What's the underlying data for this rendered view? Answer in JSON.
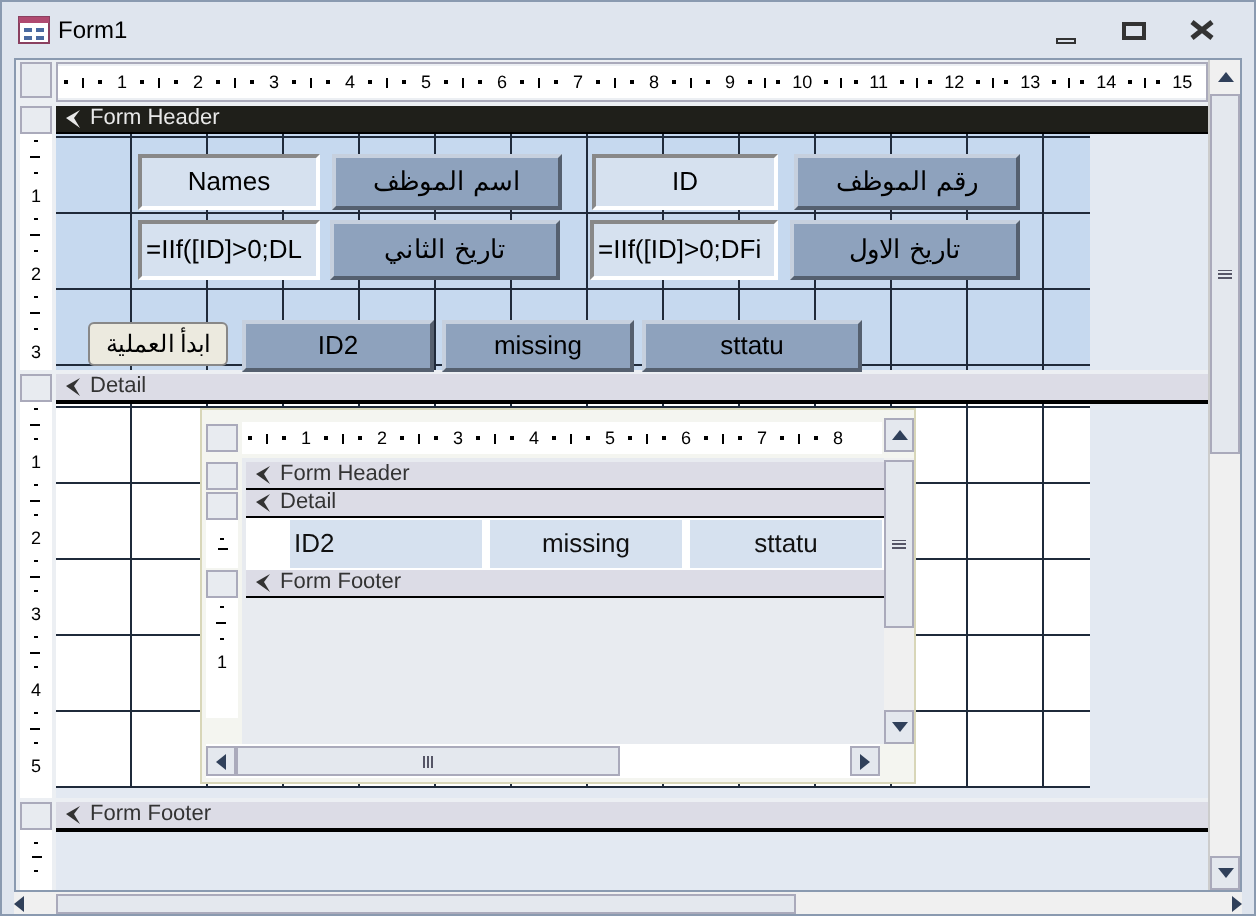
{
  "window": {
    "title": "Form1"
  },
  "ruler": [
    "1",
    "2",
    "3",
    "4",
    "5",
    "6",
    "7",
    "8",
    "9",
    "10",
    "11",
    "12",
    "13",
    "14",
    "15"
  ],
  "sections": [
    {
      "kind": "header",
      "title": "Form Header",
      "selected": true,
      "ruler": [
        "1",
        "2",
        "3"
      ],
      "controls": [
        {
          "kind": "textbox",
          "text": "Names"
        },
        {
          "kind": "label",
          "text": "اسم الموظف"
        },
        {
          "kind": "textbox",
          "text": "ID"
        },
        {
          "kind": "label",
          "text": "رقم الموظف"
        },
        {
          "kind": "textbox",
          "text": "=IIf([ID]>0;DL"
        },
        {
          "kind": "label",
          "text": "تاريخ الثاني"
        },
        {
          "kind": "textbox",
          "text": "=IIf([ID]>0;DFi"
        },
        {
          "kind": "label",
          "text": "تاريخ الاول"
        },
        {
          "kind": "button",
          "text": "ابدأ العملية"
        },
        {
          "kind": "label",
          "text": "ID2"
        },
        {
          "kind": "label",
          "text": "missing"
        },
        {
          "kind": "label",
          "text": "sttatu"
        }
      ]
    },
    {
      "kind": "detail",
      "title": "Detail",
      "selected": false,
      "ruler": [
        "1",
        "2",
        "3",
        "4",
        "5"
      ],
      "subform": {
        "ruler": [
          "1",
          "2",
          "3",
          "4",
          "5",
          "6",
          "7",
          "8"
        ],
        "sections": [
          {
            "kind": "header",
            "title": "Form Header"
          },
          {
            "kind": "detail",
            "title": "Detail",
            "controls": [
              {
                "text": "ID2"
              },
              {
                "text": "missing"
              },
              {
                "text": "sttatu"
              }
            ]
          },
          {
            "kind": "footer",
            "title": "Form Footer",
            "ruler": [
              "1"
            ]
          }
        ]
      }
    },
    {
      "kind": "footer",
      "title": "Form Footer",
      "selected": false
    }
  ]
}
